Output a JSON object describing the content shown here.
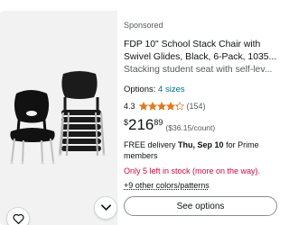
{
  "product": {
    "sponsored_label": "Sponsored",
    "title_line1": "FDP 10\" School Stack Chair with",
    "title_line2": "Swivel Glides, Black, 6-Pack, 1035...",
    "subtitle": "Stacking student seat with self-lev...",
    "options_label": "Options:",
    "options_link": "4 sizes",
    "rating": "4.3",
    "rating_stars": 4.3,
    "review_count": "(154)",
    "price_symbol": "$",
    "price_whole": "216",
    "price_fraction": "89",
    "unit_price": "($36.15/count)",
    "delivery_prefix": "FREE delivery",
    "delivery_date": "Thu, Sep 10",
    "delivery_suffix": "for Prime members",
    "stock": "Only 5 left in stock (more on the way).",
    "more_options": "+9 other colors/patterns",
    "cta_label": "See options"
  },
  "icons": {
    "wishlist": "heart-icon",
    "more": "chevron-down-icon",
    "star": "star-icon"
  },
  "colors": {
    "link": "#007185",
    "star": "#de7921",
    "stock": "#cc0c39",
    "image_bg": "#f2f2f2"
  }
}
